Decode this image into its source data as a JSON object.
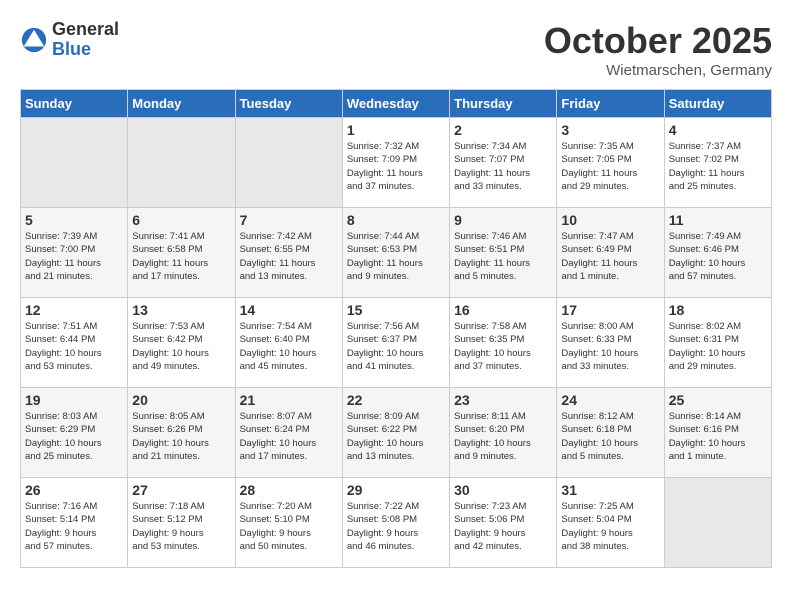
{
  "logo": {
    "general": "General",
    "blue": "Blue"
  },
  "title": "October 2025",
  "location": "Wietmarschen, Germany",
  "days_header": [
    "Sunday",
    "Monday",
    "Tuesday",
    "Wednesday",
    "Thursday",
    "Friday",
    "Saturday"
  ],
  "weeks": [
    [
      {
        "num": "",
        "info": ""
      },
      {
        "num": "",
        "info": ""
      },
      {
        "num": "",
        "info": ""
      },
      {
        "num": "1",
        "info": "Sunrise: 7:32 AM\nSunset: 7:09 PM\nDaylight: 11 hours\nand 37 minutes."
      },
      {
        "num": "2",
        "info": "Sunrise: 7:34 AM\nSunset: 7:07 PM\nDaylight: 11 hours\nand 33 minutes."
      },
      {
        "num": "3",
        "info": "Sunrise: 7:35 AM\nSunset: 7:05 PM\nDaylight: 11 hours\nand 29 minutes."
      },
      {
        "num": "4",
        "info": "Sunrise: 7:37 AM\nSunset: 7:02 PM\nDaylight: 11 hours\nand 25 minutes."
      }
    ],
    [
      {
        "num": "5",
        "info": "Sunrise: 7:39 AM\nSunset: 7:00 PM\nDaylight: 11 hours\nand 21 minutes."
      },
      {
        "num": "6",
        "info": "Sunrise: 7:41 AM\nSunset: 6:58 PM\nDaylight: 11 hours\nand 17 minutes."
      },
      {
        "num": "7",
        "info": "Sunrise: 7:42 AM\nSunset: 6:55 PM\nDaylight: 11 hours\nand 13 minutes."
      },
      {
        "num": "8",
        "info": "Sunrise: 7:44 AM\nSunset: 6:53 PM\nDaylight: 11 hours\nand 9 minutes."
      },
      {
        "num": "9",
        "info": "Sunrise: 7:46 AM\nSunset: 6:51 PM\nDaylight: 11 hours\nand 5 minutes."
      },
      {
        "num": "10",
        "info": "Sunrise: 7:47 AM\nSunset: 6:49 PM\nDaylight: 11 hours\nand 1 minute."
      },
      {
        "num": "11",
        "info": "Sunrise: 7:49 AM\nSunset: 6:46 PM\nDaylight: 10 hours\nand 57 minutes."
      }
    ],
    [
      {
        "num": "12",
        "info": "Sunrise: 7:51 AM\nSunset: 6:44 PM\nDaylight: 10 hours\nand 53 minutes."
      },
      {
        "num": "13",
        "info": "Sunrise: 7:53 AM\nSunset: 6:42 PM\nDaylight: 10 hours\nand 49 minutes."
      },
      {
        "num": "14",
        "info": "Sunrise: 7:54 AM\nSunset: 6:40 PM\nDaylight: 10 hours\nand 45 minutes."
      },
      {
        "num": "15",
        "info": "Sunrise: 7:56 AM\nSunset: 6:37 PM\nDaylight: 10 hours\nand 41 minutes."
      },
      {
        "num": "16",
        "info": "Sunrise: 7:58 AM\nSunset: 6:35 PM\nDaylight: 10 hours\nand 37 minutes."
      },
      {
        "num": "17",
        "info": "Sunrise: 8:00 AM\nSunset: 6:33 PM\nDaylight: 10 hours\nand 33 minutes."
      },
      {
        "num": "18",
        "info": "Sunrise: 8:02 AM\nSunset: 6:31 PM\nDaylight: 10 hours\nand 29 minutes."
      }
    ],
    [
      {
        "num": "19",
        "info": "Sunrise: 8:03 AM\nSunset: 6:29 PM\nDaylight: 10 hours\nand 25 minutes."
      },
      {
        "num": "20",
        "info": "Sunrise: 8:05 AM\nSunset: 6:26 PM\nDaylight: 10 hours\nand 21 minutes."
      },
      {
        "num": "21",
        "info": "Sunrise: 8:07 AM\nSunset: 6:24 PM\nDaylight: 10 hours\nand 17 minutes."
      },
      {
        "num": "22",
        "info": "Sunrise: 8:09 AM\nSunset: 6:22 PM\nDaylight: 10 hours\nand 13 minutes."
      },
      {
        "num": "23",
        "info": "Sunrise: 8:11 AM\nSunset: 6:20 PM\nDaylight: 10 hours\nand 9 minutes."
      },
      {
        "num": "24",
        "info": "Sunrise: 8:12 AM\nSunset: 6:18 PM\nDaylight: 10 hours\nand 5 minutes."
      },
      {
        "num": "25",
        "info": "Sunrise: 8:14 AM\nSunset: 6:16 PM\nDaylight: 10 hours\nand 1 minute."
      }
    ],
    [
      {
        "num": "26",
        "info": "Sunrise: 7:16 AM\nSunset: 5:14 PM\nDaylight: 9 hours\nand 57 minutes."
      },
      {
        "num": "27",
        "info": "Sunrise: 7:18 AM\nSunset: 5:12 PM\nDaylight: 9 hours\nand 53 minutes."
      },
      {
        "num": "28",
        "info": "Sunrise: 7:20 AM\nSunset: 5:10 PM\nDaylight: 9 hours\nand 50 minutes."
      },
      {
        "num": "29",
        "info": "Sunrise: 7:22 AM\nSunset: 5:08 PM\nDaylight: 9 hours\nand 46 minutes."
      },
      {
        "num": "30",
        "info": "Sunrise: 7:23 AM\nSunset: 5:06 PM\nDaylight: 9 hours\nand 42 minutes."
      },
      {
        "num": "31",
        "info": "Sunrise: 7:25 AM\nSunset: 5:04 PM\nDaylight: 9 hours\nand 38 minutes."
      },
      {
        "num": "",
        "info": ""
      }
    ]
  ]
}
